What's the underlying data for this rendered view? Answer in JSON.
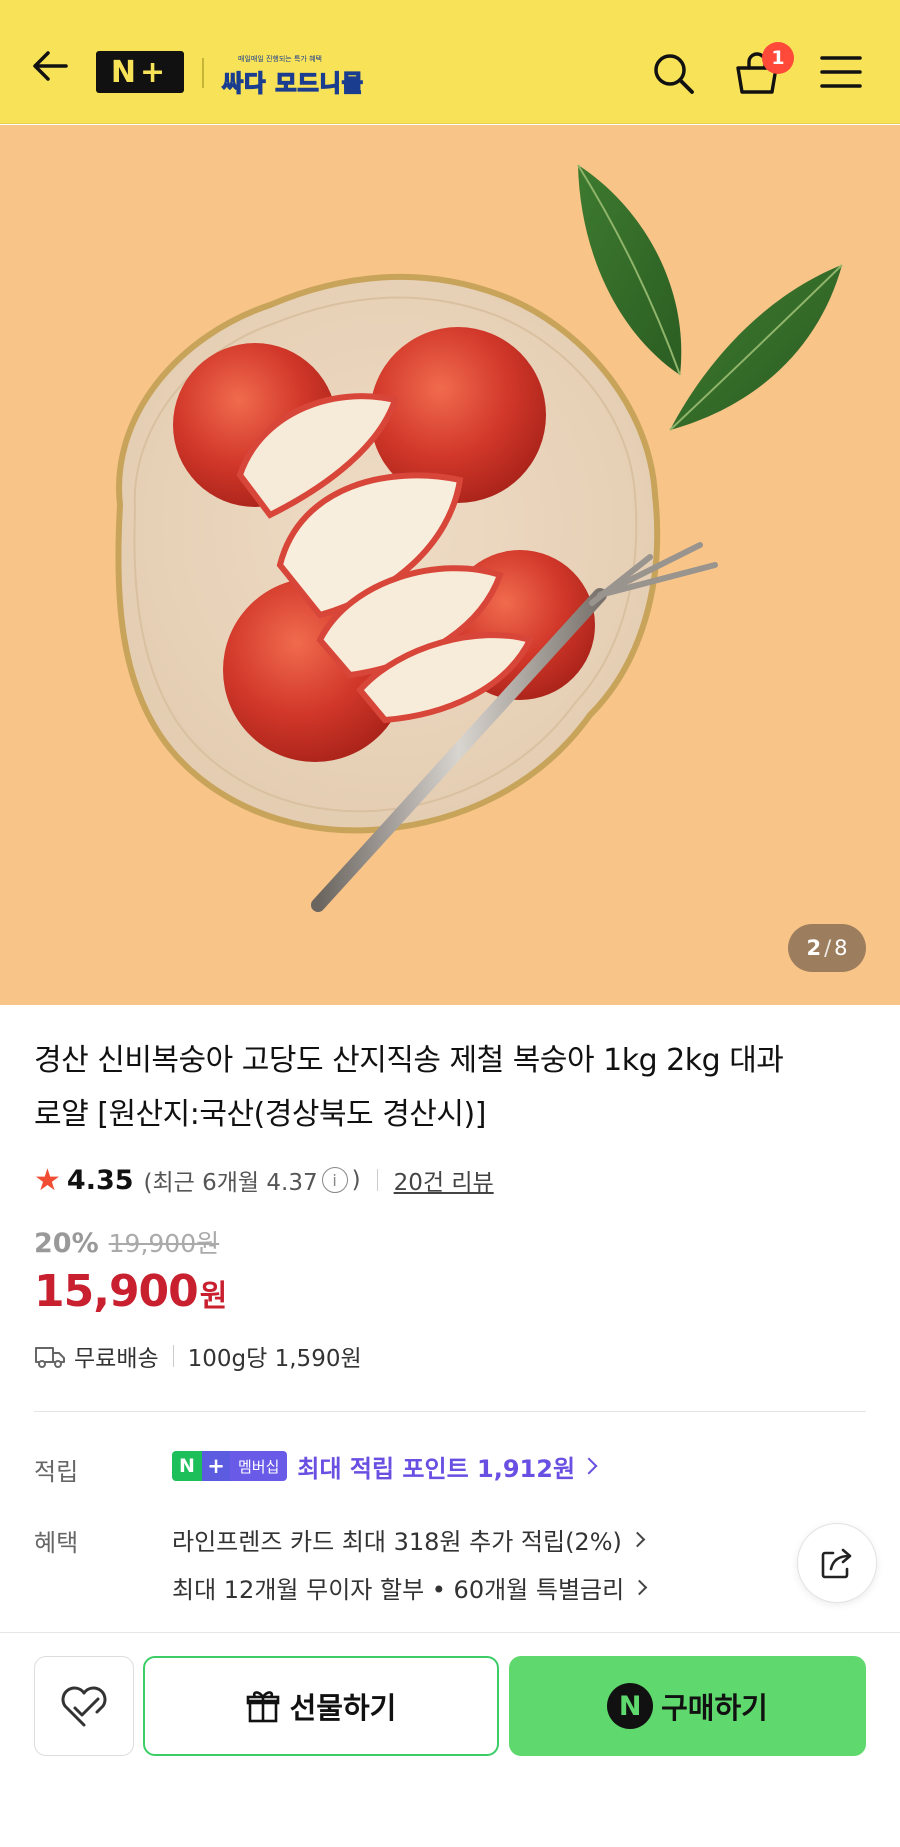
{
  "header": {
    "back_icon": "arrow-left-icon",
    "np_logo": "N+",
    "store_sub": "매일매일 진행되는 특가 혜택",
    "store_name": "싸다 모드니몰",
    "cart_count": "1",
    "background": "#f8e358"
  },
  "gallery": {
    "current": "2",
    "separator": "/",
    "total": "8"
  },
  "product": {
    "title_line1": "경산 신비복숭아 고당도 산지직송 제철 복숭아 1kg 2kg 대과",
    "title_line2": "로얄 [원산지:국산(경상북도 경산시)]",
    "rating": "4.35",
    "rating_recent_prefix": "(최근 6개월 4.37",
    "rating_recent_suffix": ")",
    "review_link": "20건 리뷰",
    "discount": "20%",
    "original_price": "19,900원",
    "price": "15,900",
    "price_unit": "원",
    "shipping": "무료배송",
    "unit_price": "100g당 1,590원"
  },
  "points": {
    "label": "적립",
    "badge_n": "N",
    "badge_plus": "+",
    "badge_text": "멤버십",
    "text": "최대 적립 포인트 1,912원"
  },
  "benefits": {
    "label": "혜택",
    "line1": "라인프렌즈 카드 최대 318원 추가 적립(2%)",
    "line2": "최대 12개월 무이자 할부 • 60개월 특별금리"
  },
  "actions": {
    "gift": "선물하기",
    "buy_n": "N",
    "buy": "구매하기"
  },
  "colors": {
    "accent_green": "#5fd96d",
    "price_red": "#c8202e",
    "points_purple": "#6a4fe3"
  }
}
